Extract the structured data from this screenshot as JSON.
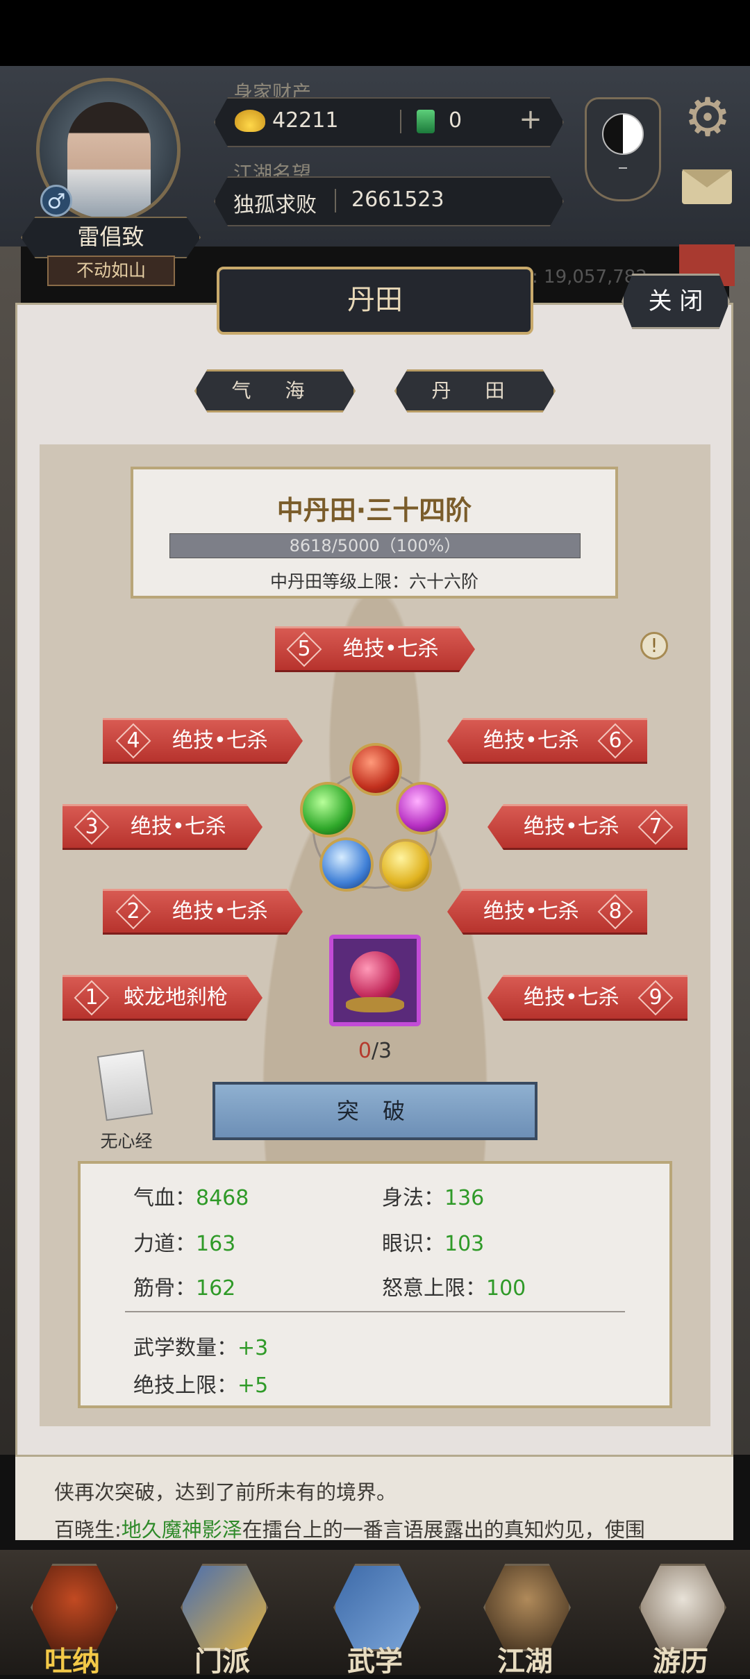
{
  "player": {
    "name": "雷倡致",
    "title": "不动如山",
    "gender_icon": "♂"
  },
  "header": {
    "wealth_label": "身家财产",
    "gold": "42211",
    "jade": "0",
    "reputation_label": "江湖名望",
    "rank_title": "独孤求败",
    "reputation_value": "2661523",
    "behind_info": "生: 19,057,782"
  },
  "panel": {
    "title": "丹田",
    "close_label": "关 闭",
    "tabs": [
      "气 海",
      "丹 田"
    ]
  },
  "level": {
    "title": "中丹田·三十四阶",
    "progress_text": "8618/5000（100%）",
    "progress_fraction": 1.0,
    "cap_text": "中丹田等级上限：六十六阶"
  },
  "skills": [
    {
      "num": "1",
      "label": "蛟龙地刹枪"
    },
    {
      "num": "2",
      "label": "绝技•七杀"
    },
    {
      "num": "3",
      "label": "绝技•七杀"
    },
    {
      "num": "4",
      "label": "绝技•七杀"
    },
    {
      "num": "5",
      "label": "绝技•七杀"
    },
    {
      "num": "6",
      "label": "绝技•七杀"
    },
    {
      "num": "7",
      "label": "绝技•七杀"
    },
    {
      "num": "8",
      "label": "绝技•七杀"
    },
    {
      "num": "9",
      "label": "绝技•七杀"
    }
  ],
  "warn_icon": "!",
  "pill": {
    "count_current": "0",
    "count_total": "/3"
  },
  "book_label": "无心经",
  "breakthrough_label": "突 破",
  "stats": {
    "qixue_label": "气血：",
    "qixue": "8468",
    "shenfa_label": "身法：",
    "shenfa": "136",
    "lidao_label": "力道：",
    "lidao": "163",
    "yanshi_label": "眼识：",
    "yanshi": "103",
    "jingu_label": "筋骨：",
    "jingu": "162",
    "nuyi_label": "怒意上限：",
    "nuyi": "100",
    "wuxue_label": "武学数量：",
    "wuxue": "+3",
    "jueji_label": "绝技上限：",
    "jueji": "+5"
  },
  "log": {
    "line1": "侠再次突破，达到了前所未有的境界。",
    "line2_prefix": "百晓生:",
    "line2_name": "地久魔神影泽",
    "line2_rest": "在擂台上的一番言语展露出的真知灼见，使围"
  },
  "nav": [
    "吐纳",
    "门派",
    "武学",
    "江湖",
    "游历"
  ],
  "colors": {
    "accent_gold": "#c9aa6c",
    "skill_red": "#c9433b",
    "stat_green": "#2f9a28",
    "pill_purple": "#c24bd6"
  }
}
